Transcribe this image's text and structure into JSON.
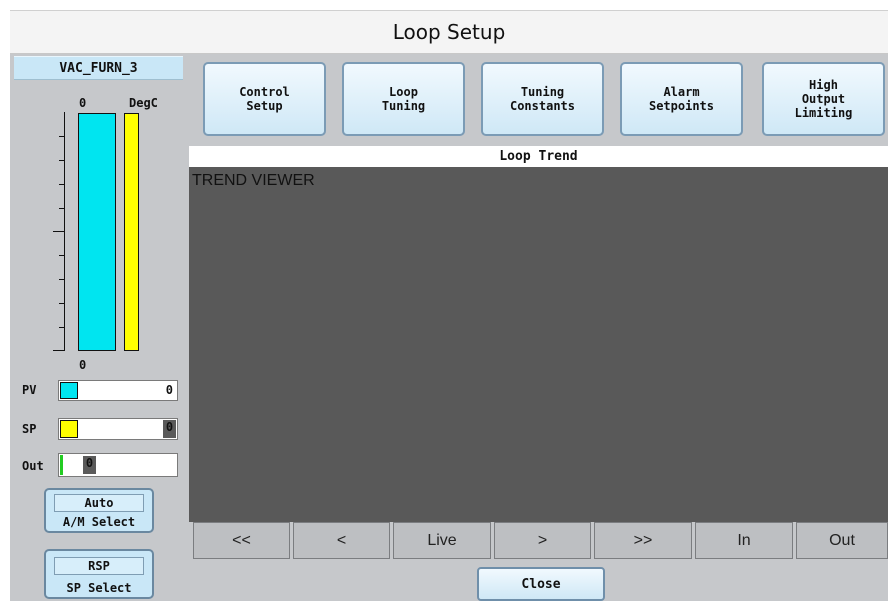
{
  "window": {
    "title": "Loop Setup"
  },
  "loop": {
    "name": "VAC_FURN_3",
    "scale_top": "0",
    "units": "DegC",
    "scale_bottom": "0"
  },
  "readouts": {
    "pv": {
      "label": "PV",
      "value": "0",
      "color": "#00e5f0"
    },
    "sp": {
      "label": "SP",
      "value": "0",
      "color": "#ffff00"
    },
    "out": {
      "label": "Out",
      "value": "0",
      "color": "#22cc22"
    }
  },
  "toggles": {
    "am": {
      "state": "Auto",
      "label": "A/M Select"
    },
    "sp": {
      "state": "RSP",
      "label": "SP Select"
    }
  },
  "nav": [
    {
      "label": "Control\nSetup"
    },
    {
      "label": "Loop\nTuning"
    },
    {
      "label": "Tuning\nConstants"
    },
    {
      "label": "Alarm\nSetpoints"
    },
    {
      "label": "High\nOutput\nLimiting"
    }
  ],
  "trend": {
    "header": "Loop Trend",
    "viewer_label": "TREND VIEWER",
    "buttons": [
      "<<",
      "<",
      "Live",
      ">",
      ">>",
      "In",
      "Out"
    ]
  },
  "close_label": "Close"
}
